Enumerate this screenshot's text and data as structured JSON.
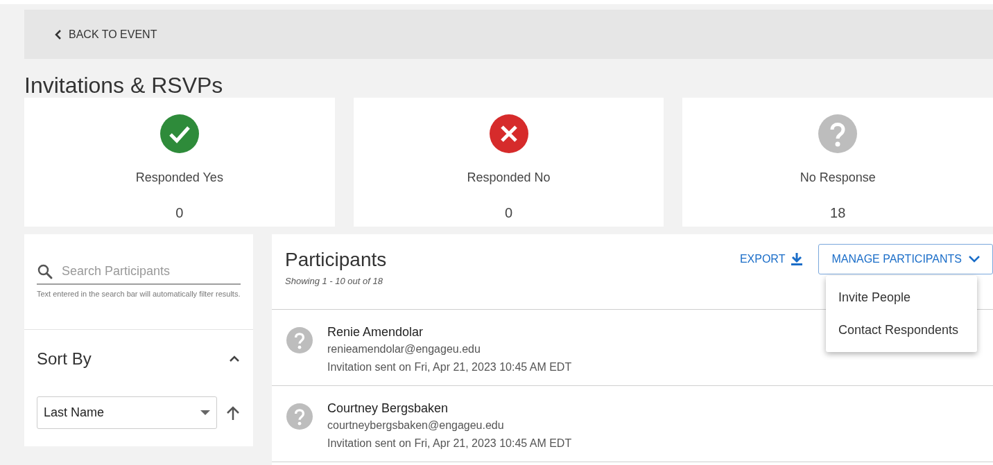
{
  "back_link": {
    "label": "BACK TO EVENT"
  },
  "title": "Invitations & RSVPs",
  "stats": [
    {
      "kind": "yes",
      "label": "Responded Yes",
      "count": "0"
    },
    {
      "kind": "no",
      "label": "Responded No",
      "count": "0"
    },
    {
      "kind": "none",
      "label": "No Response",
      "count": "18"
    }
  ],
  "sidebar": {
    "search": {
      "placeholder": "Search Participants",
      "hint": "Text entered in the search bar will automatically filter results."
    },
    "sort": {
      "title": "Sort By",
      "expanded": true,
      "value": "Last Name"
    }
  },
  "participants": {
    "title": "Participants",
    "summary": "Showing 1 - 10 out of 18",
    "export_label": "EXPORT",
    "manage": {
      "label": "MANAGE PARTICIPANTS",
      "expanded": true,
      "menu": [
        "Invite People",
        "Contact Respondents"
      ]
    },
    "rows": [
      {
        "kind": "none",
        "name": "Renie Amendolar",
        "email": "renieamendolar@engageu.edu",
        "sent": "Invitation sent on Fri, Apr 21, 2023 10:45 AM EDT"
      },
      {
        "kind": "none",
        "name": "Courtney Bergsbaken",
        "email": "courtneybergsbaken@engageu.edu",
        "sent": "Invitation sent on Fri, Apr 21, 2023 10:45 AM EDT"
      }
    ]
  }
}
